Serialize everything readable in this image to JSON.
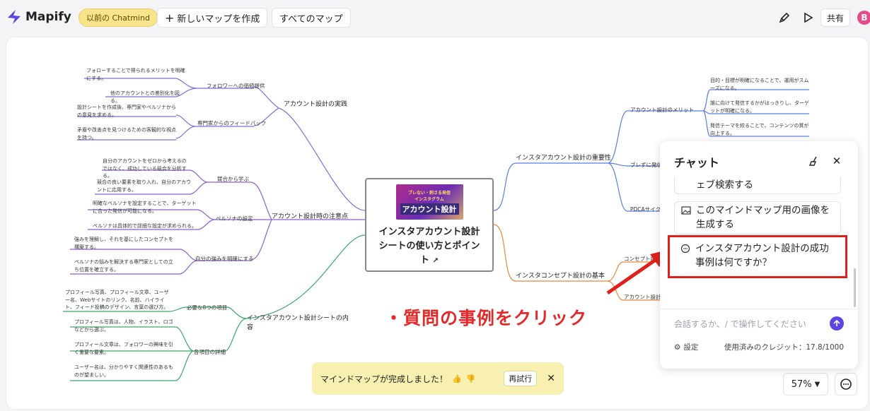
{
  "app": {
    "name": "Mapify",
    "legacy_label": "以前の Chatmind",
    "new_map": "新しいマップを作成",
    "all_maps": "すべてのマップ",
    "share": "共有",
    "avatar_letter": "B"
  },
  "colors": {
    "accent": "#5a46e0",
    "annotation": "#e32a2a",
    "branch_purple": "#7c6fd6",
    "branch_blue": "#5b7de0",
    "branch_orange": "#e8863a",
    "branch_green": "#3aa86a"
  },
  "mindmap": {
    "center_title": "インスタアカウント設計シートの使い方とポイント",
    "thumb_small": "ブレない・刺さる発信",
    "thumb_big": "アカウント設計",
    "thumb_small2": "インスタグラム",
    "left": [
      {
        "branch": "アカウント設計の実践",
        "mids": [
          {
            "label": "フォロワーへの価値提供",
            "leaves": [
              "フォローすることで得られるメリットを明確にする。",
              "他のアカウントとの差別化を図る。"
            ]
          },
          {
            "label": "専門家からのフィードバック",
            "leaves": [
              "設計シートを作成後、専門家やペルソナからの意見を求める。",
              "矛盾や改善点を見つけるための客観的な視点を持つ。"
            ]
          }
        ]
      },
      {
        "branch": "アカウント設計時の注意点",
        "mids": [
          {
            "label": "競合から学ぶ",
            "leaves": [
              "自分のアカウントをゼロから考えるのではなく、成功している競合を分析する。",
              "競合の良い要素を取り入れ、自分のアカウントに応用する。"
            ]
          },
          {
            "label": "ペルソナの設定",
            "leaves": [
              "明確なペルソナを設定することで、ターゲットに合った発信が可能になる。",
              "ペルソナは具体的で詳細な設定が求められる。"
            ]
          },
          {
            "label": "自分の強みを明確にする",
            "leaves": [
              "強みを理解し、それを基にしたコンセプトを構築する。",
              "ペルソナの悩みを解決する専門家としての立ち位置を確立する。"
            ]
          }
        ]
      },
      {
        "branch": "インスタアカウント設計シートの内容",
        "mids": [
          {
            "label": "必要な8つの項目",
            "leaves": [
              "プロフィール写真、プロフィール文章、ユーザー名、Webサイトのリンク、名前、ハイライト、フィード投稿のデザイン、言葉の選び方。"
            ]
          },
          {
            "label": "各項目の詳細",
            "leaves": [
              "プロフィール写真は、人物、イラスト、ロゴなどから選ぶ。",
              "プロフィール文章は、フォロワーの興味を引く重要な要素。",
              "ユーザー名は、分かりやすく関連性のあるものが望ましい。"
            ]
          }
        ]
      }
    ],
    "right": [
      {
        "branch": "インスタアカウント設計の重要性",
        "mids": [
          {
            "label": "アカウント設計のメリット",
            "leaves": [
              "目的・目標が明確になることで、運用がスムーズになる。",
              "誰に向けて発信するかがはっきりし、ターゲットが明確になる。",
              "発信テーマを絞ることで、コンテンツの質が向上する。"
            ]
          },
          {
            "label": "ブレずに発信",
            "leaves": []
          },
          {
            "label": "PDCAサイクル",
            "leaves": []
          }
        ]
      },
      {
        "branch": "インスタコンセプト設計の基本",
        "mids": [
          {
            "label": "コンセプト設計",
            "leaves": []
          },
          {
            "label": "アカウント設計シ",
            "leaves": []
          }
        ]
      }
    ]
  },
  "annotation": "・質問の事例をクリック",
  "toast": {
    "message": "マインドマップが完成しました！",
    "retry": "再試行"
  },
  "zoom": "57%",
  "chat": {
    "title": "チャット",
    "suggestions": [
      "ェブ検索する",
      "このマインドマップ用の画像を生成する",
      "インスタアカウント設計の成功事例は何ですか？"
    ],
    "input_placeholder": "会話するか、/ で操作してください",
    "settings": "設定",
    "credits": "使用済みのクレジット：17.8/1000"
  }
}
